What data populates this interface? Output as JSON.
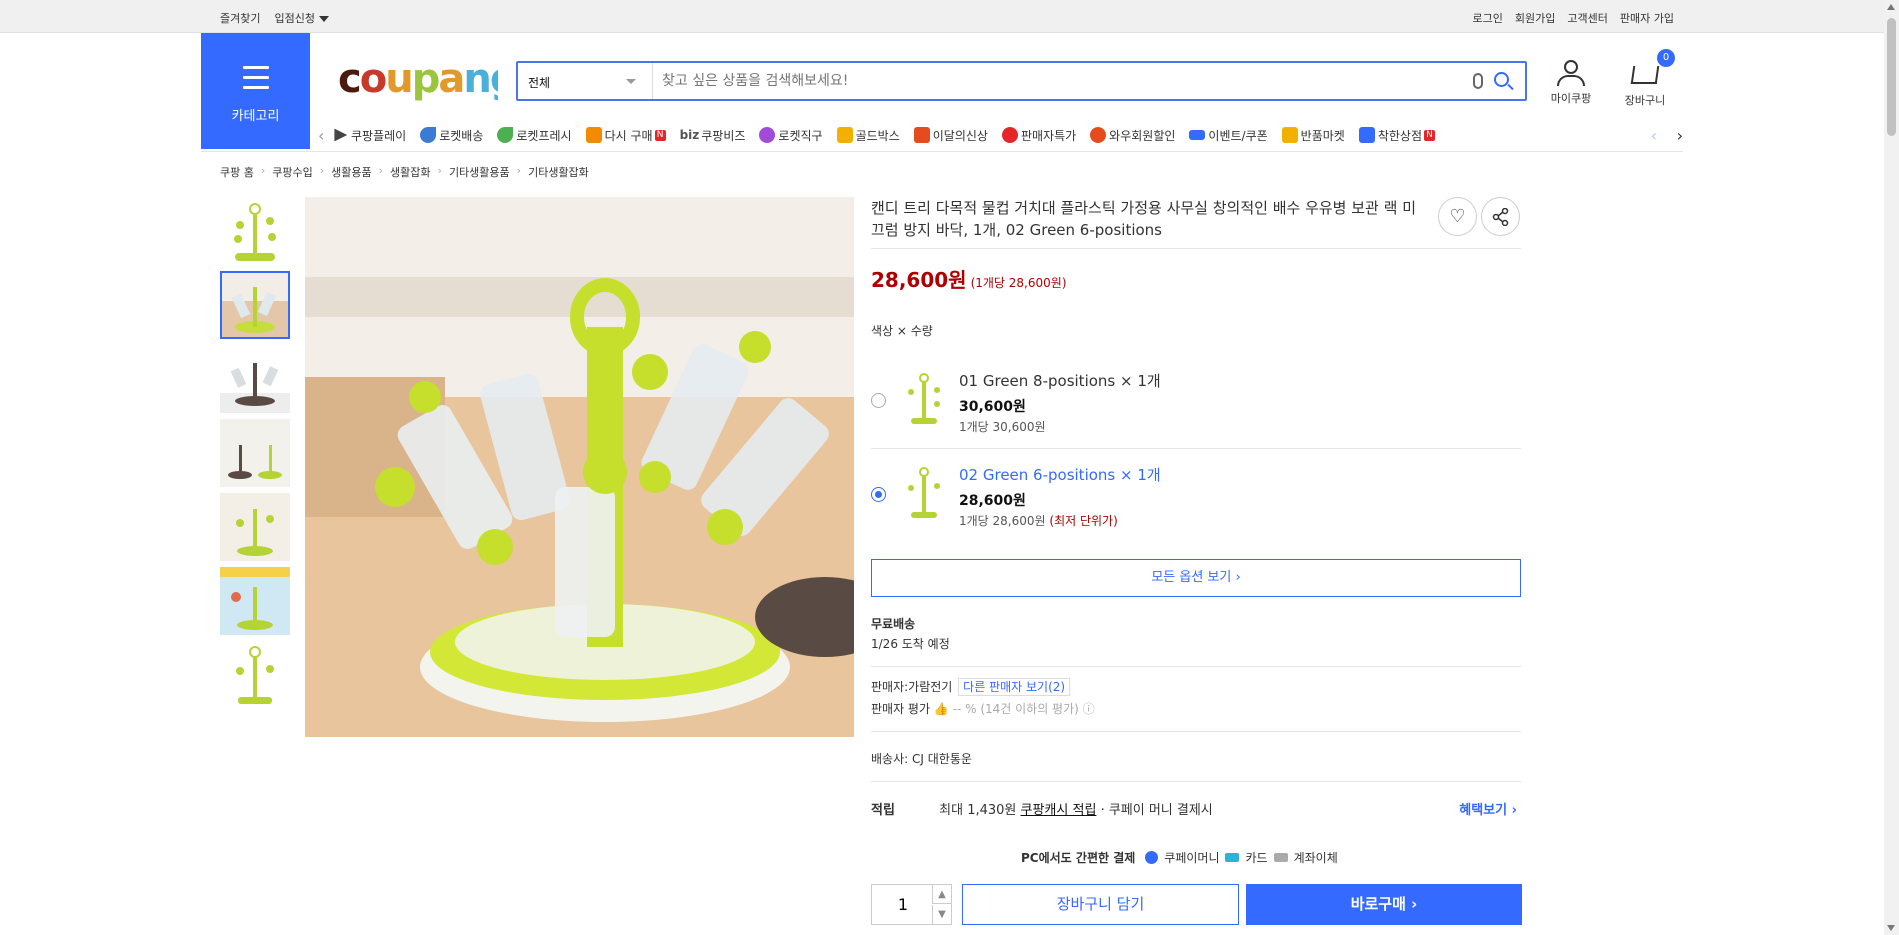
{
  "topbar": {
    "favorite": "즐겨찾기",
    "entry": "입점신청",
    "login": "로그인",
    "signup": "회원가입",
    "cs": "고객센터",
    "seller_signup": "판매자 가입"
  },
  "category_button": {
    "label": "카테고리"
  },
  "logo": {
    "text": "coupang"
  },
  "search": {
    "category": "전체",
    "placeholder": "찾고 싶은 상품을 검색해보세요!"
  },
  "header": {
    "mycoupang": "마이쿠팡",
    "cart": "장바구니",
    "cart_count": "0"
  },
  "catnav": [
    {
      "label": "쿠팡플레이",
      "icon": "play-icon",
      "color": "#444"
    },
    {
      "label": "로켓배송",
      "icon": "rocket-icon",
      "color": "#3a7bd5"
    },
    {
      "label": "로켓프레시",
      "icon": "rocket-fresh-icon",
      "color": "#4caf50"
    },
    {
      "label": "다시 구매",
      "icon": "rebuy-icon",
      "color": "#f38b00"
    },
    {
      "label": "쿠팡비즈",
      "icon": "biz-icon",
      "color": "#555"
    },
    {
      "label": "로켓직구",
      "icon": "global-rocket-icon",
      "color": "#a24bd8"
    },
    {
      "label": "골드박스",
      "icon": "goldbox-icon",
      "color": "#f3b000"
    },
    {
      "label": "이달의신상",
      "icon": "new-bag-icon",
      "color": "#e64b1e"
    },
    {
      "label": "판매자특가",
      "icon": "percent-icon",
      "color": "#e52528"
    },
    {
      "label": "와우회원할인",
      "icon": "wow-icon",
      "color": "#e64b1e"
    },
    {
      "label": "이벤트/쿠폰",
      "icon": "coupon-icon",
      "color": "#346aff"
    },
    {
      "label": "반품마켓",
      "icon": "return-market-icon",
      "color": "#f3b000"
    },
    {
      "label": "착한상점",
      "icon": "good-store-icon",
      "color": "#346aff"
    }
  ],
  "breadcrumb": [
    "쿠팡 홈",
    "쿠팡수입",
    "생활용품",
    "생활잡화",
    "기타생활용품",
    "기타생활잡화"
  ],
  "product": {
    "title": "캔디 트리 다목적 물컵 거치대 플라스틱 가정용 사무실 창의적인 배수 우유병 보관 랙 미끄럼 방지 바닥, 1개, 02 Green 6-positions",
    "price": "28,600원",
    "unit_price": "(1개당 28,600원)",
    "option_label": "색상 × 수량",
    "options": [
      {
        "name": "01 Green 8-positions × 1개",
        "price": "30,600원",
        "per": "1개당 30,600원",
        "lowest": "",
        "selected": false
      },
      {
        "name": "02 Green 6-positions × 1개",
        "price": "28,600원",
        "per": "1개당 28,600원",
        "lowest": "(최저 단위가)",
        "selected": true
      }
    ],
    "all_options": "모든 옵션 보기 ›",
    "shipping_type": "무료배송",
    "arrival": "1/26 도착 예정",
    "seller_label": "판매자:",
    "seller_name": "가람전기",
    "other_sellers": "다른 판매자 보기(2)",
    "seller_rating_label": "판매자 평가",
    "seller_rating": "-- % (14건 이하의 평가)",
    "carrier_label": "배송사:",
    "carrier": "CJ 대한통운"
  },
  "reward": {
    "label": "적립",
    "text": "최대 1,430원",
    "cash": "쿠팡캐시 적립",
    "extra": "· 쿠페이 머니 결제시",
    "benefit": "혜택보기 ›"
  },
  "pay": {
    "intro": "PC에서도 간편한 결제",
    "coupay": "쿠페이머니",
    "card": "카드",
    "transfer": "계좌이체"
  },
  "purchase": {
    "qty": "1",
    "add_cart": "장바구니 담기",
    "buy_now": "바로구매 ›"
  },
  "colors": {
    "accent": "#346aff",
    "price_red": "#ae0000"
  }
}
